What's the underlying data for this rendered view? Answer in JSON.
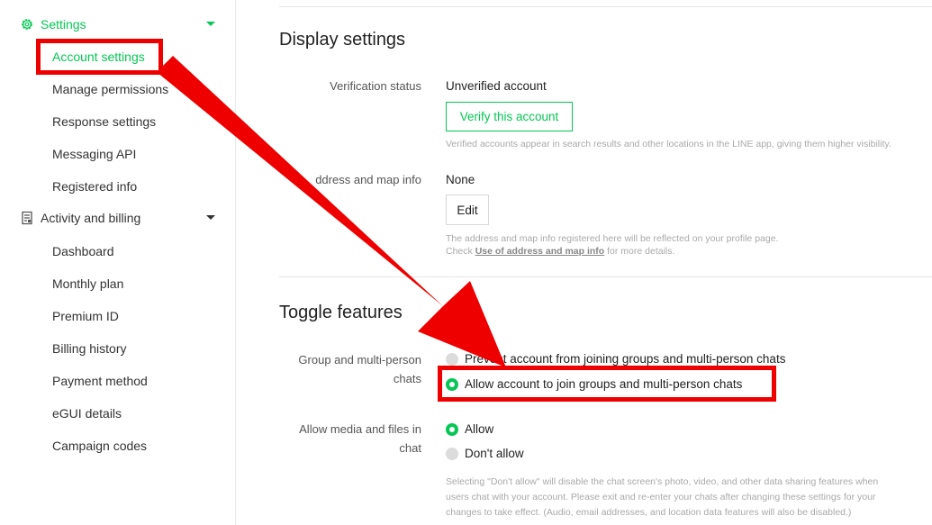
{
  "sidebar": {
    "groups": [
      {
        "label": "Settings",
        "icon": "gear-icon",
        "items": [
          "Account settings",
          "Manage permissions",
          "Response settings",
          "Messaging API",
          "Registered info"
        ]
      },
      {
        "label": "Activity and billing",
        "icon": "receipt-icon",
        "items": [
          "Dashboard",
          "Monthly plan",
          "Premium ID",
          "Billing history",
          "Payment method",
          "eGUI details",
          "Campaign codes"
        ]
      }
    ],
    "active_item": "Account settings"
  },
  "display_settings": {
    "title": "Display settings",
    "verification": {
      "label": "Verification status",
      "value": "Unverified account",
      "button": "Verify this account",
      "help": "Verified accounts appear in search results and other locations in the LINE app, giving them higher visibility."
    },
    "address": {
      "label": "ddress and map info",
      "value": "None",
      "button": "Edit",
      "help_line1": "The address and map info registered here will be reflected on your profile page.",
      "help_line2_prefix": "Check ",
      "help_link": "Use of address and map info",
      "help_line2_suffix": " for more details."
    }
  },
  "toggle_features": {
    "title": "Toggle features",
    "groups": {
      "label_line1": "Group and multi-person",
      "label_line2": "chats",
      "options": [
        {
          "label": "Prevent account from joining groups and multi-person chats",
          "selected": false
        },
        {
          "label": "Allow account to join groups and multi-person chats",
          "selected": true
        }
      ]
    },
    "media": {
      "label_line1": "Allow media and files in",
      "label_line2": "chat",
      "options": [
        {
          "label": "Allow",
          "selected": true
        },
        {
          "label": "Don't allow",
          "selected": false
        }
      ],
      "help_line1": "Selecting \"Don't allow\" will disable the chat screen's photo, video, and other data sharing features when",
      "help_line2": "users chat with your account. Please exit and re-enter your chats after changing these settings for your",
      "help_line3": "changes to take effect. (Audio, email addresses, and location data features will also be disabled.)"
    }
  },
  "colors": {
    "accent": "#06c755",
    "annotation": "#ee0000"
  }
}
